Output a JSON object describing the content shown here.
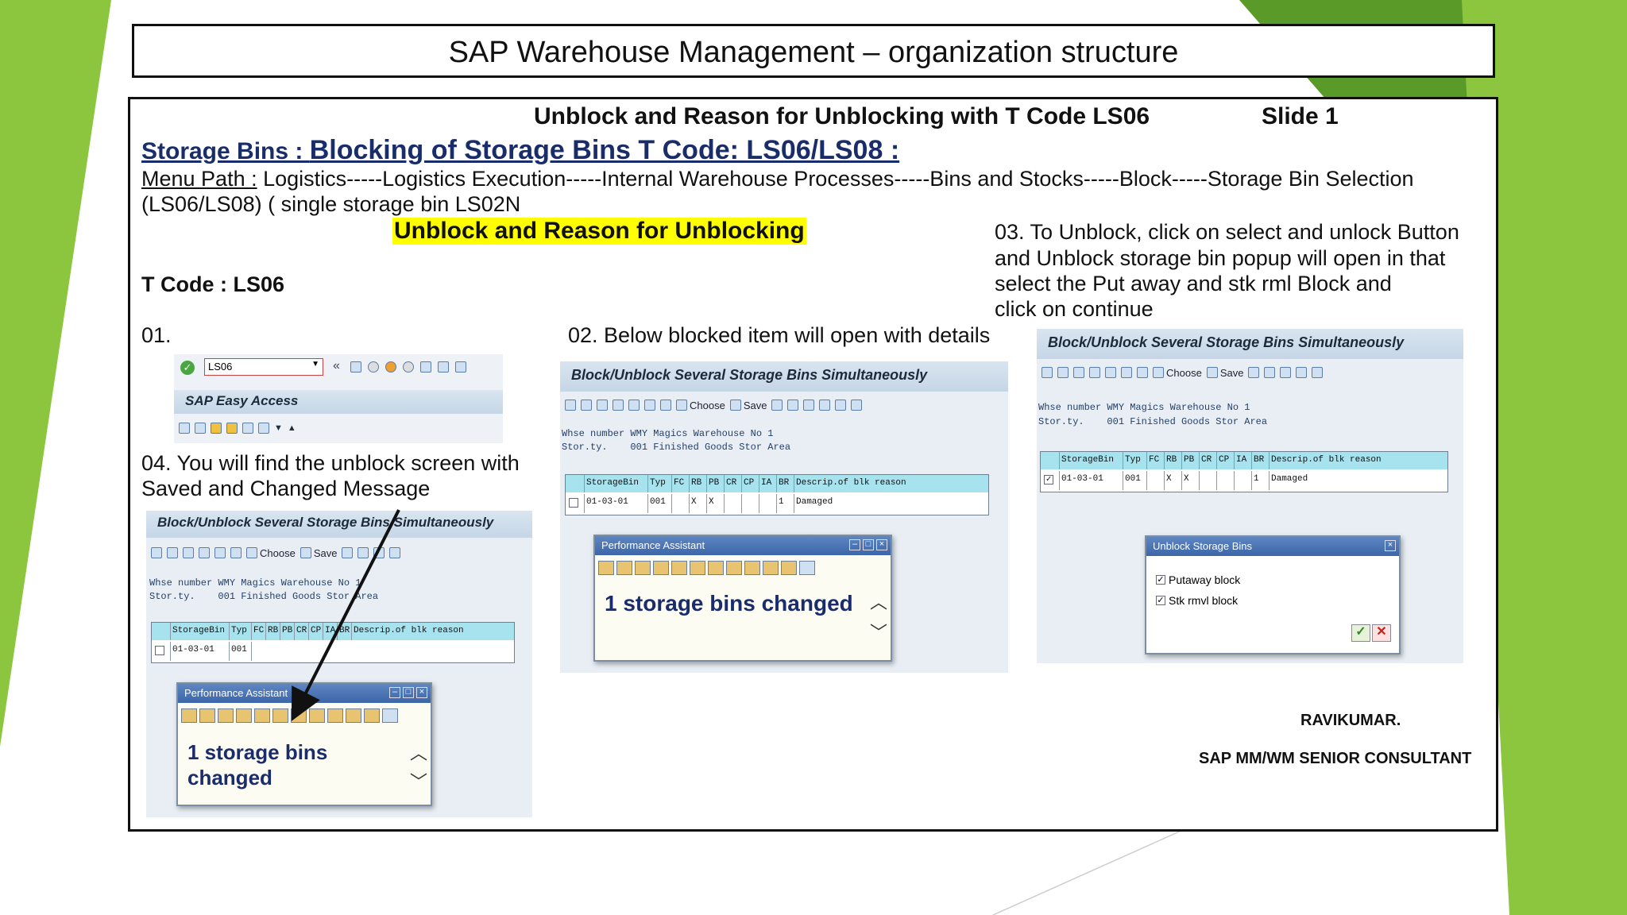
{
  "title": "SAP Warehouse Management – organization structure",
  "header": {
    "subtitle": "Unblock and Reason for Unblocking with T Code LS06",
    "slide": "Slide 1"
  },
  "heading": {
    "prefix": "Storage Bins : ",
    "main": "Blocking of Storage Bins T Code: LS06/LS08 :"
  },
  "menu_path": {
    "label": "Menu Path :",
    "line1": " Logistics-----Logistics Execution-----Internal Warehouse Processes-----Bins and Stocks-----Block-----Storage Bin Selection",
    "line2": "(LS06/LS08) ( single storage bin LS02N"
  },
  "highlight": "Unblock and Reason for Unblocking",
  "tcode": "T Code : LS06",
  "steps": {
    "s01": "01.",
    "s02": "02. Below blocked item will open with details",
    "s03": [
      "03. To Unblock, click on select and unlock Button",
      "and Unblock storage bin popup will open in that",
      "select the Put away and stk rml Block and",
      "click on continue"
    ],
    "s04": [
      "04. You will find the unblock screen with",
      "Saved and Changed Message"
    ]
  },
  "sap": {
    "command_value": "LS06",
    "easy_access": "SAP Easy Access",
    "screen_title": "Block/Unblock Several Storage Bins Simultaneously",
    "choose": "Choose",
    "save": "Save",
    "whse_line": "Whse number WMY Magics Warehouse No 1",
    "stor_line": "Stor.ty.    001 Finished Goods Stor Area",
    "columns": [
      "StorageBin",
      "Typ",
      "FC",
      "RB",
      "PB",
      "CR",
      "CP",
      "IA",
      "BR",
      "Descrip.of blk reason"
    ],
    "row": [
      "01-03-01",
      "001",
      "",
      "X",
      "X",
      "",
      "",
      "",
      "1",
      "Damaged"
    ],
    "perf_title": "Performance Assistant",
    "perf_msg": "1 storage bins changed",
    "unblock_title": "Unblock Storage Bins",
    "putaway": "Putaway block",
    "stkrmvl": "Stk rmvl block"
  },
  "author": {
    "name": "RAVIKUMAR.",
    "role": "SAP MM/WM  SENIOR CONSULTANT"
  },
  "colors": {
    "green_light": "#8cc63f",
    "green_dark": "#5a9a28",
    "highlight": "#ffff00",
    "grid_header": "#a7e3ee",
    "sap_blue": "#3c66a8"
  }
}
